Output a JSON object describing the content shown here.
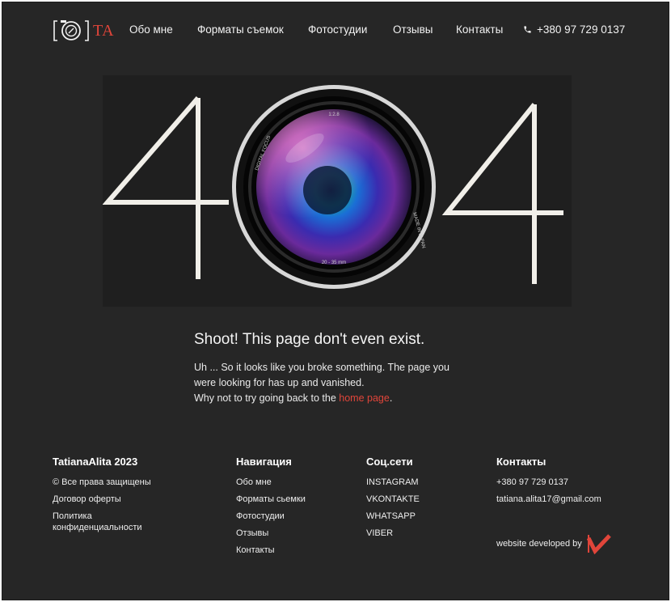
{
  "header": {
    "logo_text": "TA",
    "nav": [
      "Обо мне",
      "Форматы съемок",
      "Фотостудии",
      "Отзывы",
      "Контакты"
    ],
    "phone": "+380 97 729 0137"
  },
  "hero": {
    "left_digit": "4",
    "right_digit": "4",
    "lens_text_top": "1:2.8",
    "lens_text_left": "DIGITAL FOCUS",
    "lens_text_right": "MADE IN JAPAN",
    "lens_text_bottom": "20 - 35 mm"
  },
  "message": {
    "title": "Shoot! This page don't even exist.",
    "line1": "Uh ... So it looks like you broke something. The page you",
    "line2": "were looking for has up and vanished.",
    "line3_pre": "Why not to try going back to the ",
    "home_link": "home page",
    "line3_post": "."
  },
  "footer": {
    "brand": {
      "title": "TatianaAlita 2023",
      "items": [
        "© Все права защищены",
        "Договор оферты",
        "Политика конфиденциальности"
      ]
    },
    "nav": {
      "title": "Навигация",
      "items": [
        "Обо мне",
        "Форматы сьемки",
        "Фотостудии",
        "Отзывы",
        "Контакты"
      ]
    },
    "social": {
      "title": "Соц.сети",
      "items": [
        "INSTAGRAM",
        "VKONTAKTE",
        "WHATSAPP",
        "VIBER"
      ]
    },
    "contacts": {
      "title": "Контакты",
      "phone": "+380 97 729 0137",
      "email": "tatiana.alita17@gmail.com",
      "developed_by": "website developed by"
    }
  },
  "colors": {
    "background": "#262626",
    "accent": "#e0453a",
    "text": "#ffffff"
  }
}
